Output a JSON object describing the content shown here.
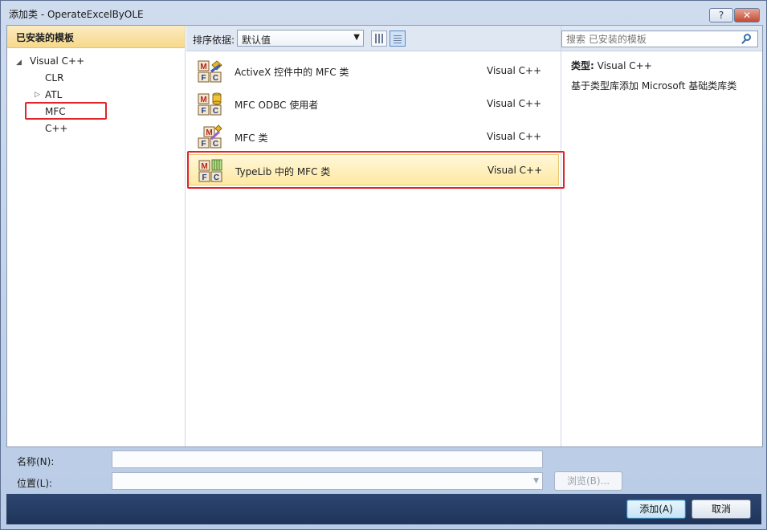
{
  "window": {
    "title": "添加类 - OperateExcelByOLE",
    "help_label": "?",
    "close_label": "✕"
  },
  "left_pane": {
    "header": "已安装的模板",
    "tree": [
      {
        "label": "Visual C++",
        "arrow": "◢"
      },
      {
        "label": "CLR",
        "arrow": ""
      },
      {
        "label": "ATL",
        "arrow": "▷"
      },
      {
        "label": "MFC",
        "arrow": ""
      },
      {
        "label": "C++",
        "arrow": ""
      }
    ]
  },
  "sortbar": {
    "label": "排序依据:",
    "selected": "默认值",
    "arrow": "▼"
  },
  "templates": [
    {
      "name": "ActiveX 控件中的 MFC 类",
      "language": "Visual C++"
    },
    {
      "name": "MFC ODBC 使用者",
      "language": "Visual C++"
    },
    {
      "name": "MFC 类",
      "language": "Visual C++"
    },
    {
      "name": "TypeLib 中的 MFC 类",
      "language": "Visual C++"
    }
  ],
  "search": {
    "placeholder": "搜索 已安装的模板"
  },
  "details": {
    "type_label": "类型:",
    "type_value": "Visual C++",
    "description": "基于类型库添加 Microsoft 基础类库类"
  },
  "form": {
    "name_label": "名称(N):",
    "location_label": "位置(L):",
    "browse_label": "浏览(B)...",
    "combo_arrow": "▼"
  },
  "buttons": {
    "add_label": "添加(A)",
    "cancel_label": "取消"
  },
  "icon_letters": {
    "m": "M",
    "f": "F",
    "c": "C"
  },
  "colors": {
    "highlight_box": "#e0242b",
    "selected_row": "#fde9a4",
    "footer": "#1f3459"
  }
}
